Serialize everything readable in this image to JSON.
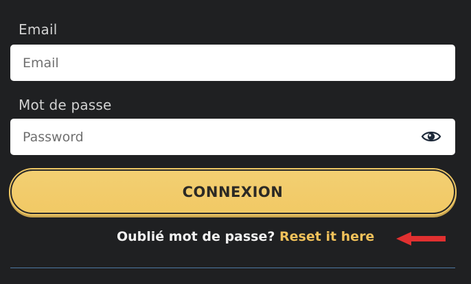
{
  "form": {
    "email_label": "Email",
    "email_placeholder": "Email",
    "email_value": "",
    "password_label": "Mot de passe",
    "password_placeholder": "Password",
    "password_value": "",
    "password_toggle_icon": "eye-icon",
    "submit_label": "CONNEXION"
  },
  "forgot": {
    "text": "Oublié mot de passe?",
    "link_label": "Reset it here"
  },
  "annotation": {
    "arrow_icon": "left-arrow-icon"
  },
  "colors": {
    "background": "#1f2022",
    "accent": "#f1c965",
    "link": "#f0c15a",
    "arrow": "#e03030",
    "divider": "#4e7aa5"
  }
}
